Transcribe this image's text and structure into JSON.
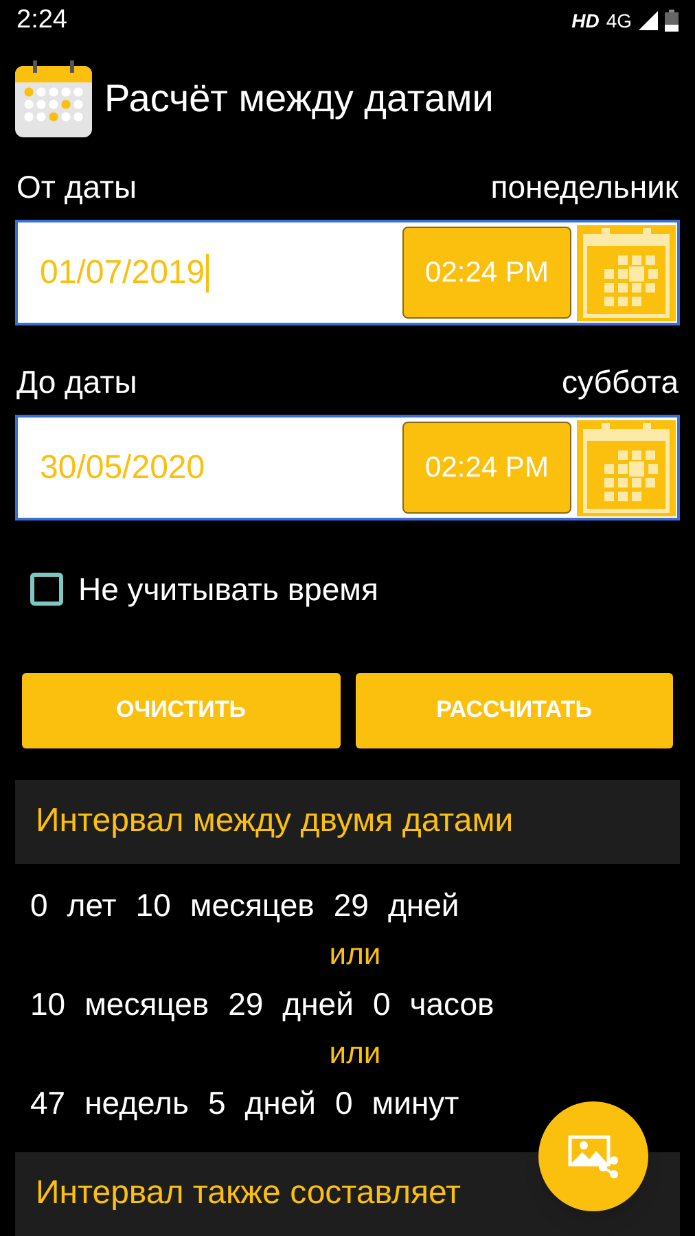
{
  "status_bar": {
    "time": "2:24",
    "network": "HD",
    "network_type": "4G"
  },
  "app_bar": {
    "title": "Расчёт между датами"
  },
  "from": {
    "label": "От даты",
    "weekday": "понедельник",
    "date": "01/07/2019",
    "time": "02:24 PM",
    "focused": true
  },
  "to": {
    "label": "До даты",
    "weekday": "суббота",
    "date": "30/05/2020",
    "time": "02:24 PM",
    "focused": false
  },
  "ignore_time": {
    "label": "Не учитывать время",
    "checked": false
  },
  "buttons": [
    {
      "label": "ОЧИСТИТЬ"
    },
    {
      "label": "РАССЧИТАТЬ"
    }
  ],
  "interval": {
    "title": "Интервал между двумя датами",
    "lines": [
      {
        "kind": "values",
        "parts": [
          "0",
          "лет",
          "10",
          "месяцев",
          "29",
          "дней"
        ]
      },
      {
        "kind": "or",
        "text": "или"
      },
      {
        "kind": "values",
        "parts": [
          "10",
          "месяцев",
          "29",
          "дней",
          "0",
          "часов"
        ]
      },
      {
        "kind": "or",
        "text": "или"
      },
      {
        "kind": "values",
        "parts": [
          "47",
          "недель",
          "5",
          "дней",
          "0",
          "минут"
        ]
      }
    ]
  },
  "also": {
    "title": "Интервал также составляет"
  }
}
